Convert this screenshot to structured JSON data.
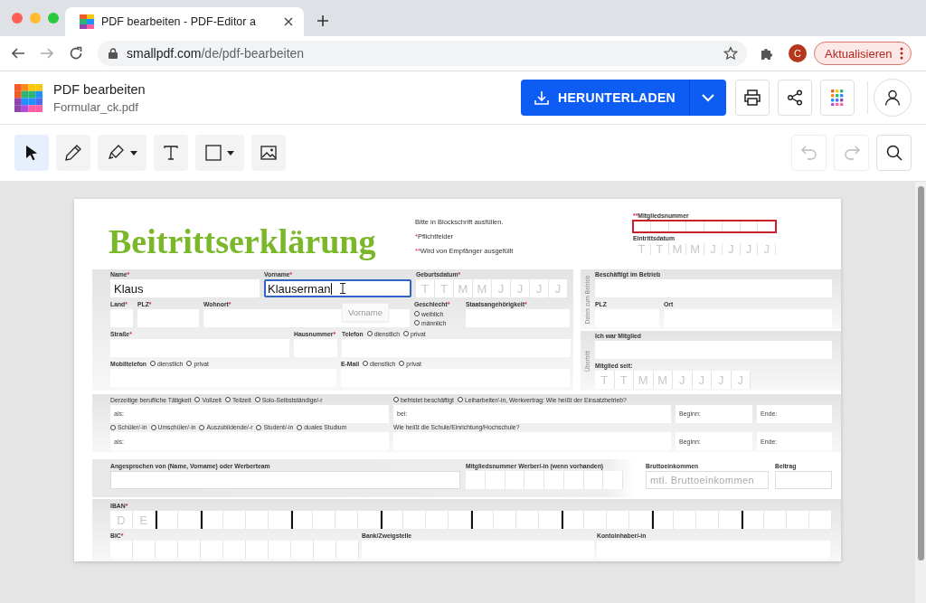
{
  "browser": {
    "tab_title": "PDF bearbeiten - PDF-Editor a",
    "url_host": "smallpdf.com",
    "url_path": "/de/pdf-bearbeiten",
    "profile_initial": "C",
    "update_button": "Aktualisieren"
  },
  "app": {
    "title": "PDF bearbeiten",
    "filename": "Formular_ck.pdf",
    "download": "HERUNTERLADEN"
  },
  "tools": [
    {
      "kind": "select",
      "selected": true
    },
    {
      "kind": "pen",
      "selected": false
    },
    {
      "kind": "marker",
      "selected": false
    },
    {
      "kind": "text",
      "selected": false
    },
    {
      "kind": "shape",
      "selected": false
    },
    {
      "kind": "image",
      "selected": false
    }
  ],
  "history_tools": [
    {
      "kind": "undo",
      "disabled": true
    },
    {
      "kind": "redo",
      "disabled": true
    },
    {
      "kind": "search",
      "disabled": false
    }
  ],
  "form": {
    "title": "Beitrittserklärung",
    "notes": [
      {
        "text": "Bitte in Blockschrift ausfüllen."
      },
      {
        "mark": "*",
        "text": "Pflichtfelder"
      },
      {
        "mark": "**",
        "text": "Wird von Empfänger ausgefüllt"
      }
    ],
    "member_number": {
      "kind": "comb",
      "prefix": "**",
      "label": "Mitgliedsnummer",
      "highlighted": true
    },
    "entry_date": {
      "kind": "comb",
      "label": "Eintrittsdatum",
      "placeholder": [
        "T",
        "T",
        "M",
        "M",
        "J",
        "J",
        "J",
        "J"
      ]
    },
    "personal": [
      [
        {
          "kind": "text",
          "label": "Name",
          "mark": "*",
          "value": "Klaus"
        },
        {
          "kind": "text",
          "label": "Vorname",
          "mark": "*",
          "value": "Klauserman",
          "focused": true,
          "tooltip": "Vorname"
        },
        {
          "kind": "comb",
          "label": "Geburtsdatum",
          "mark": "*",
          "placeholder": [
            "T",
            "T",
            "M",
            "M",
            "J",
            "J",
            "J",
            "J"
          ]
        }
      ],
      [
        {
          "kind": "text",
          "label": "Land",
          "mark": "*"
        },
        {
          "kind": "text",
          "label": "PLZ",
          "mark": "*"
        },
        {
          "kind": "text",
          "label": "Wohnort",
          "mark": "*"
        },
        {
          "kind": "choice",
          "label": "Geschlecht",
          "mark": "*",
          "options": [
            {
              "label": "weiblich",
              "selected": false
            },
            {
              "label": "männlich",
              "selected": false
            }
          ]
        },
        {
          "kind": "text",
          "label": "Staatsangehörigkeit",
          "mark": "*"
        }
      ],
      [
        {
          "kind": "text",
          "label": "Straße",
          "mark": "*"
        },
        {
          "kind": "text",
          "label": "Hausnummer",
          "mark": "*"
        },
        {
          "kind": "text",
          "label": "Telefon",
          "options": [
            {
              "label": "dienstlich",
              "selected": false
            },
            {
              "label": "privat",
              "selected": false
            }
          ]
        }
      ],
      [
        {
          "kind": "text",
          "label": "Mobiltelefon",
          "options": [
            {
              "label": "dienstlich",
              "selected": false
            },
            {
              "label": "privat",
              "selected": false
            }
          ]
        },
        {
          "kind": "text",
          "label": "E-Mail",
          "options": [
            {
              "label": "dienstlich",
              "selected": false
            },
            {
              "label": "privat",
              "selected": false
            }
          ]
        }
      ]
    ],
    "company": {
      "side_label": "Daten zum Betrieb",
      "rows": [
        [
          {
            "kind": "text",
            "label": "Beschäftigt im Betrieb"
          }
        ],
        [
          {
            "kind": "text",
            "label": "PLZ"
          },
          {
            "kind": "text",
            "label": "Ort"
          }
        ]
      ]
    },
    "transfer": {
      "side_label": "Übertritt",
      "rows": [
        [
          {
            "kind": "text",
            "label": "Ich war Mitglied"
          }
        ],
        [
          {
            "kind": "comb",
            "label": "Mitglied seit:",
            "placeholder": [
              "T",
              "T",
              "M",
              "M",
              "J",
              "J",
              "J",
              "J"
            ]
          }
        ]
      ]
    },
    "occupation": [
      {
        "groups": [
          {
            "label": "Derzeitige berufliche Tätigkeit",
            "options": [
              {
                "label": "Vollzeit",
                "selected": false
              },
              {
                "label": "Teilzeit",
                "selected": false
              },
              {
                "label": "Solo-Selbstständige/-r",
                "selected": false
              }
            ]
          },
          {
            "options": [
              {
                "label": "befristet beschäftigt",
                "selected": false
              },
              {
                "label": "Leiharbeiter/-in, Werkvertrag: Wie heißt der Einsatzbetrieb?",
                "selected": false
              }
            ]
          }
        ],
        "boxes": [
          {
            "kind": "text",
            "inner": "als:"
          },
          {
            "kind": "text",
            "inner": "bei:"
          },
          {
            "kind": "text",
            "inner": "Beginn:"
          },
          {
            "kind": "text",
            "inner": "Ende:"
          }
        ]
      },
      {
        "groups": [
          {
            "options": [
              {
                "label": "Schüler/-in",
                "selected": false
              },
              {
                "label": "Umschüler/-in",
                "selected": false
              },
              {
                "label": "Auszubildende/-r",
                "selected": false
              },
              {
                "label": "Student/-in",
                "selected": false
              },
              {
                "label": "duales Studium",
                "selected": false
              }
            ]
          },
          {
            "label": "Wie heißt die Schule/Einrichtung/Hochschule?"
          }
        ],
        "boxes": [
          {
            "kind": "text",
            "inner": "als:"
          },
          {
            "kind": "text"
          },
          {
            "kind": "text",
            "inner": "Beginn:"
          },
          {
            "kind": "text",
            "inner": "Ende:"
          }
        ]
      }
    ],
    "referral": [
      {
        "kind": "text",
        "label": "Angesprochen von (Name, Vorname) oder Werberteam"
      },
      {
        "kind": "comb",
        "label": "Mitgliedsnummer Werber/-in (wenn vorhanden)"
      },
      {
        "kind": "text",
        "label": "Bruttoeinkommen",
        "placeholder": "mtl. Bruttoeinkommen"
      },
      {
        "kind": "text",
        "label": "Beitrag"
      }
    ],
    "bank": [
      [
        {
          "kind": "comb",
          "label": "IBAN",
          "mark": "*",
          "placeholder": [
            "D",
            "E"
          ]
        }
      ],
      [
        {
          "kind": "comb",
          "label": "BIC",
          "mark": "*"
        },
        {
          "kind": "text",
          "label": "Bank/Zweigstelle"
        },
        {
          "kind": "text",
          "label": "Kontoinhaber/-in"
        }
      ]
    ]
  }
}
